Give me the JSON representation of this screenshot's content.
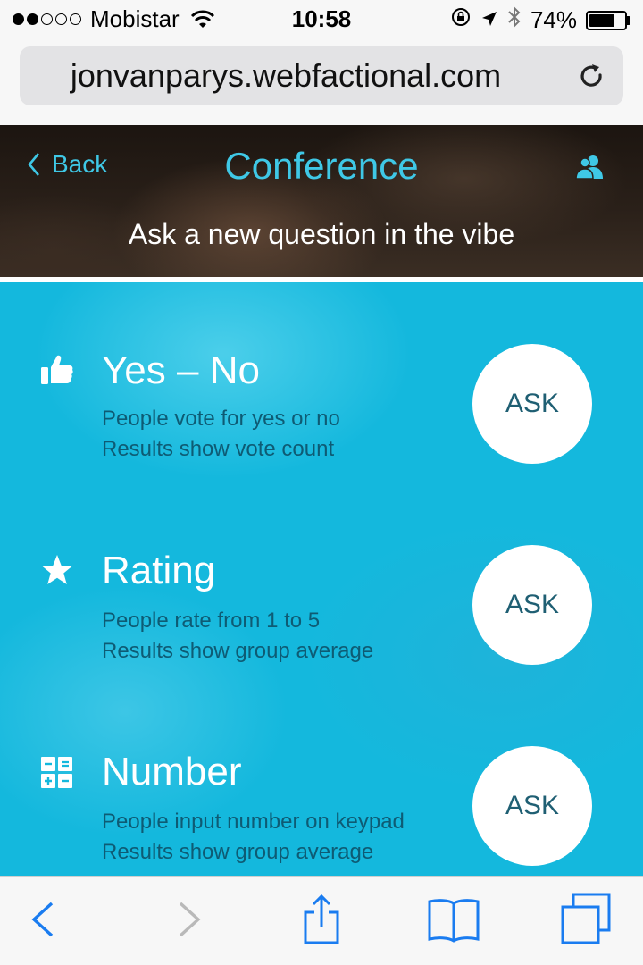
{
  "status_bar": {
    "carrier": "Mobistar",
    "time": "10:58",
    "battery": "74%",
    "battery_level": 0.74,
    "signal_bars": 2,
    "signal_total": 5
  },
  "browser": {
    "url": "jonvanparys.webfactional.com"
  },
  "header": {
    "back_label": "Back",
    "title": "Conference",
    "subtitle": "Ask a new question in the vibe"
  },
  "question_types": [
    {
      "icon": "thumbs-up-icon",
      "title": "Yes – No",
      "line1": "People vote for yes or no",
      "line2": "Results show vote count",
      "button": "ASK"
    },
    {
      "icon": "star-icon",
      "title": "Rating",
      "line1": "People rate from 1 to 5",
      "line2": "Results show group average",
      "button": "ASK"
    },
    {
      "icon": "calculator-icon",
      "title": "Number",
      "line1": "People input number on keypad",
      "line2": "Results show group average",
      "button": "ASK"
    }
  ],
  "colors": {
    "accent": "#3fc8e6",
    "main_bg": "#14b8dd",
    "desc_text": "#0e5b74",
    "ios_blue": "#1a7cf0"
  }
}
